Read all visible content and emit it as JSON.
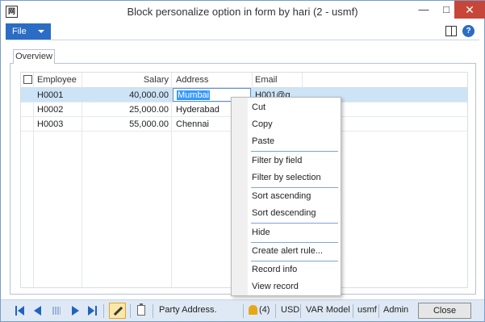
{
  "window": {
    "app_icon_text": "网",
    "title": "Block personalize option in form by hari (2 - usmf)",
    "minimize_glyph": "—",
    "maximize_glyph": "□",
    "close_glyph": "✕"
  },
  "actionbar": {
    "file_label": "File",
    "help_glyph": "?"
  },
  "tabs": [
    {
      "label": "Overview",
      "active": true
    }
  ],
  "grid": {
    "columns": [
      "Employee",
      "Salary",
      "Address",
      "Email"
    ],
    "rows": [
      {
        "employee": "H0001",
        "salary": "40,000.00",
        "address": "Mumbai",
        "email": "H001@g",
        "selected": true
      },
      {
        "employee": "H0002",
        "salary": "25,000.00",
        "address": "Hyderabad",
        "email": ""
      },
      {
        "employee": "H0003",
        "salary": "55,000.00",
        "address": "Chennai",
        "email": ""
      }
    ]
  },
  "context_menu": {
    "items": [
      "Cut",
      "Copy",
      "Paste",
      "Filter by field",
      "Filter by selection",
      "Sort ascending",
      "Sort descending",
      "Hide",
      "Create alert rule...",
      "Record info",
      "View record"
    ]
  },
  "statusbar": {
    "field_name": "Party Address.",
    "alerts": "(4)",
    "currency": "USD",
    "model": "VAR Model",
    "company": "usmf",
    "user": "Admin",
    "close_label": "Close"
  },
  "colors": {
    "accent": "#2b6cc4",
    "selected_row": "#cde4f7",
    "close_button_red": "#c7463a",
    "statusbar_bg": "#dfe9f5"
  }
}
